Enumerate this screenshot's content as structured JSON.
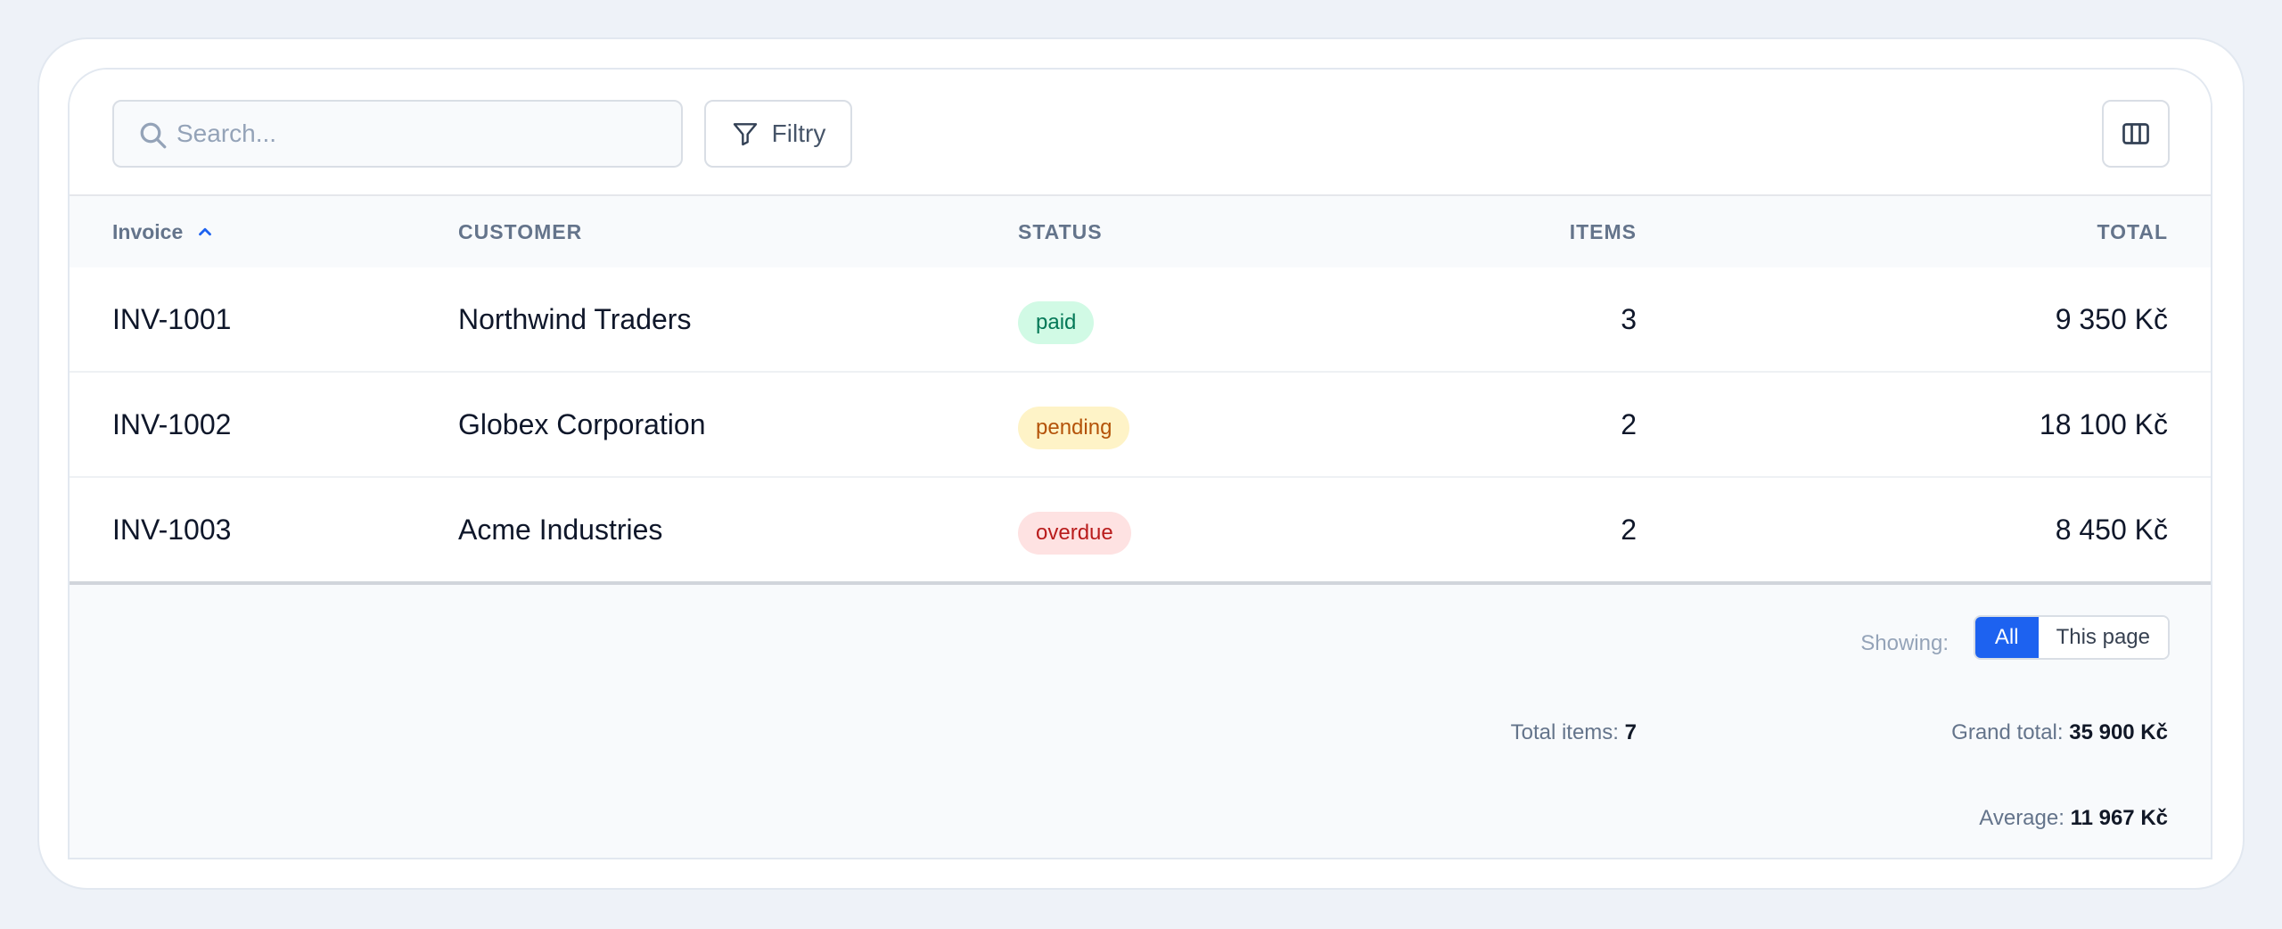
{
  "toolbar": {
    "search_placeholder": "Search...",
    "filter_label": "Filtry"
  },
  "table": {
    "headers": {
      "invoice": "Invoice",
      "customer": "CUSTOMER",
      "status": "STATUS",
      "items": "ITEMS",
      "total": "TOTAL"
    },
    "sort": {
      "column": "invoice",
      "direction": "ascending"
    },
    "rows": [
      {
        "invoice": "INV-1001",
        "customer": "Northwind Traders",
        "status": "paid",
        "items": "3",
        "total": "9 350 Kč"
      },
      {
        "invoice": "INV-1002",
        "customer": "Globex Corporation",
        "status": "pending",
        "items": "2",
        "total": "18 100 Kč"
      },
      {
        "invoice": "INV-1003",
        "customer": "Acme Industries",
        "status": "overdue",
        "items": "2",
        "total": "8 450 Kč"
      }
    ]
  },
  "status_colors": {
    "paid": {
      "bg": "#d1fae5",
      "fg": "#047857"
    },
    "pending": {
      "bg": "#fef3c7",
      "fg": "#b45309"
    },
    "overdue": {
      "bg": "#fee2e2",
      "fg": "#b91c1c"
    }
  },
  "footer": {
    "showing_label": "Showing:",
    "options": [
      "All",
      "This page"
    ],
    "selected": "All",
    "total_items_label": "Total items:",
    "total_items_value": "7",
    "grand_total_label": "Grand total:",
    "grand_total_value": "35 900 Kč",
    "average_label": "Average:",
    "average_value": "11 967 Kč"
  },
  "colors": {
    "accent": "#1d62f0"
  }
}
